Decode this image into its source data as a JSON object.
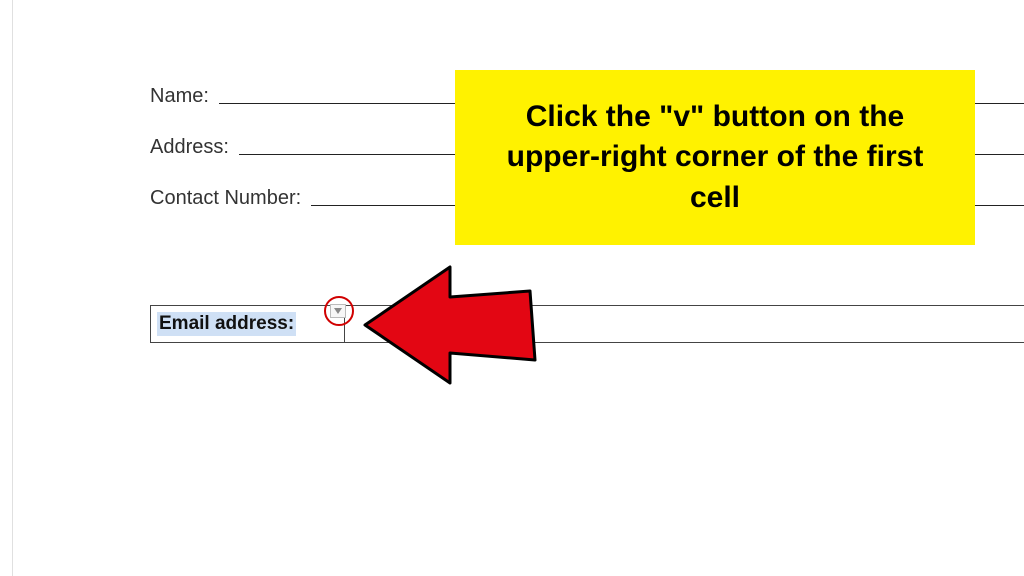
{
  "form": {
    "name_label": "Name:",
    "address_label": "Address:",
    "contact_label": "Contact Number:"
  },
  "table": {
    "first_cell_text": "Email address:"
  },
  "callout": {
    "text": "Click the \"v\" button on the upper-right corner of the first cell"
  }
}
